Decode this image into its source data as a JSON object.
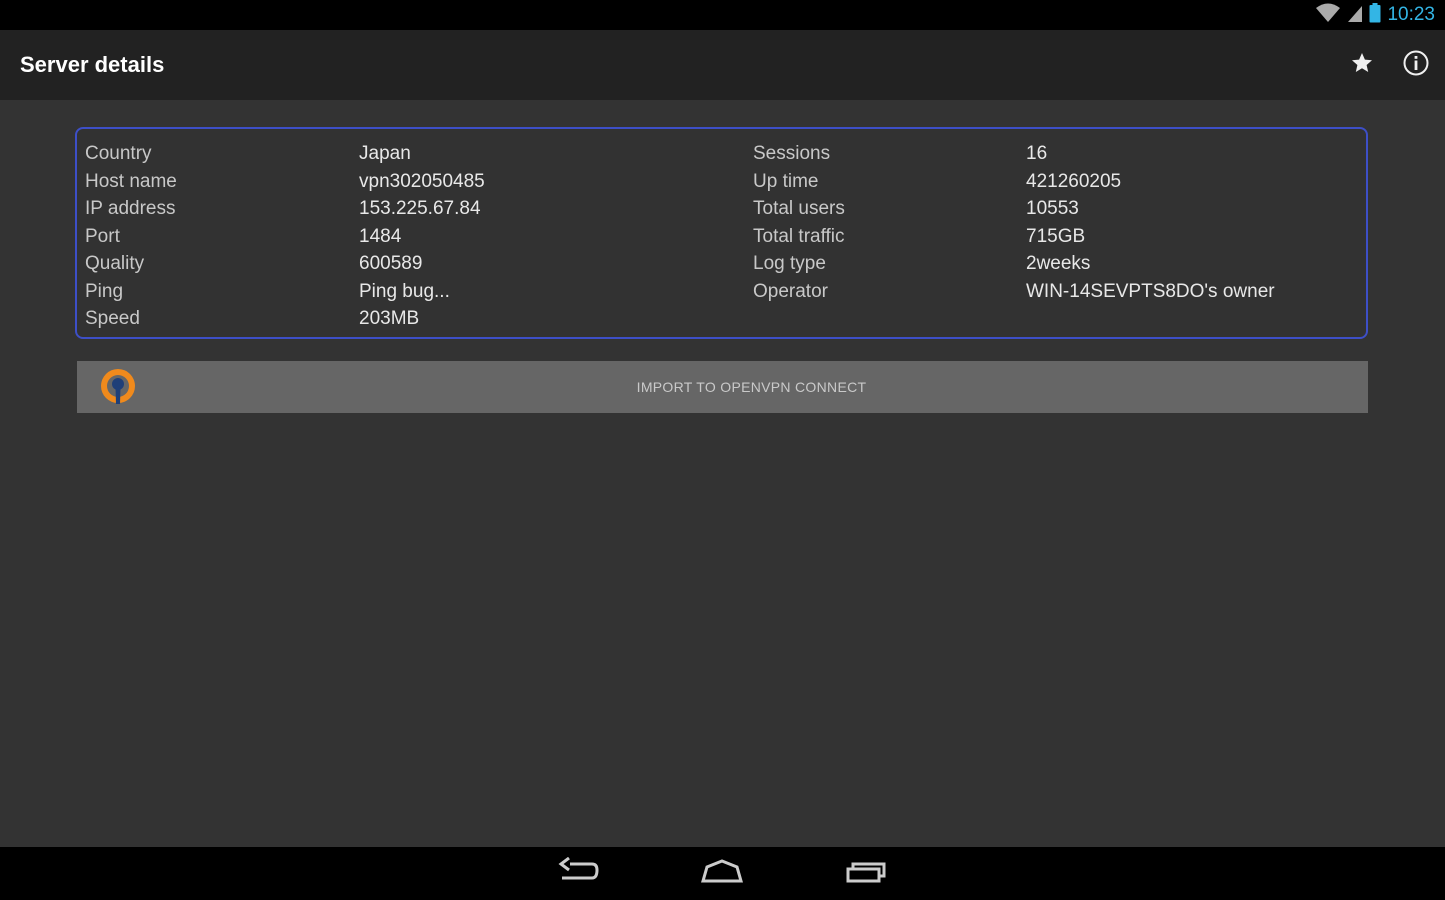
{
  "status_bar": {
    "time": "10:23",
    "icons": [
      "wifi-icon",
      "signal-icon",
      "battery-icon"
    ],
    "clock_color": "#33b5e5"
  },
  "action_bar": {
    "title": "Server details",
    "actions": [
      "star-icon",
      "info-icon"
    ]
  },
  "details": {
    "accent_border_color": "#3d4fc7",
    "left": [
      {
        "label": "Country",
        "value": "Japan"
      },
      {
        "label": "Host name",
        "value": "vpn302050485"
      },
      {
        "label": "IP address",
        "value": "153.225.67.84"
      },
      {
        "label": "Port",
        "value": "1484"
      },
      {
        "label": "Quality",
        "value": "600589"
      },
      {
        "label": "Ping",
        "value": "Ping bug..."
      },
      {
        "label": "Speed",
        "value": "203MB"
      }
    ],
    "right": [
      {
        "label": "Sessions",
        "value": "16"
      },
      {
        "label": "Up time",
        "value": "421260205"
      },
      {
        "label": "Total users",
        "value": "10553"
      },
      {
        "label": "Total traffic",
        "value": "715GB"
      },
      {
        "label": "Log type",
        "value": "2weeks"
      },
      {
        "label": "Operator",
        "value": "WIN-14SEVPTS8DO's owner"
      }
    ]
  },
  "import_button": {
    "label": "IMPORT TO OPENVPN CONNECT",
    "icon": "openvpn-icon",
    "icon_color": "#f08a1c"
  },
  "nav_bar": {
    "buttons": [
      "back-icon",
      "home-icon",
      "recents-icon"
    ]
  }
}
